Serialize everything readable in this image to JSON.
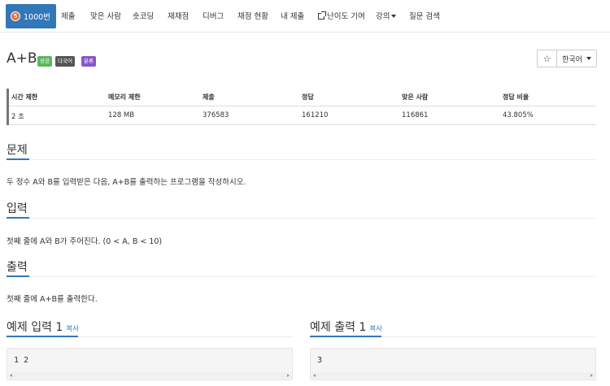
{
  "nav": {
    "problem_number": "1000번",
    "tier_badge": "5",
    "items": [
      "제출",
      "맞은 사람",
      "숏코딩",
      "재채점",
      "디버그",
      "채점 현황",
      "내 제출",
      "난이도 기여",
      "강의",
      "질문 검색"
    ]
  },
  "problem": {
    "title": "A+B",
    "labels": {
      "success": "성공",
      "multilang": "다국어",
      "classification": "분류"
    },
    "language": "한국어"
  },
  "stats": {
    "headers": [
      "시간 제한",
      "메모리 제한",
      "제출",
      "정답",
      "맞은 사람",
      "정답 비율"
    ],
    "values": [
      "2 초",
      "128 MB",
      "376583",
      "161210",
      "116861",
      "43.805%"
    ]
  },
  "sections": {
    "description": {
      "heading": "문제",
      "text": "두 정수 A와 B를 입력받은 다음, A+B를 출력하는 프로그램을 작성하시오."
    },
    "input": {
      "heading": "입력",
      "text": "첫째 줄에 A와 B가 주어진다. (0 < A, B < 10)"
    },
    "output": {
      "heading": "출력",
      "text": "첫째 줄에 A+B를 출력한다."
    }
  },
  "examples": {
    "input": {
      "heading": "예제 입력 1",
      "copy": "복사",
      "content": "1 2"
    },
    "output": {
      "heading": "예제 출력 1",
      "copy": "복사",
      "content": "3"
    }
  },
  "colors": {
    "primary": "#3277b8",
    "success": "#5cb85c",
    "multilang": "#555555",
    "classification": "#8a57c7",
    "tier": "#e86a3a"
  }
}
